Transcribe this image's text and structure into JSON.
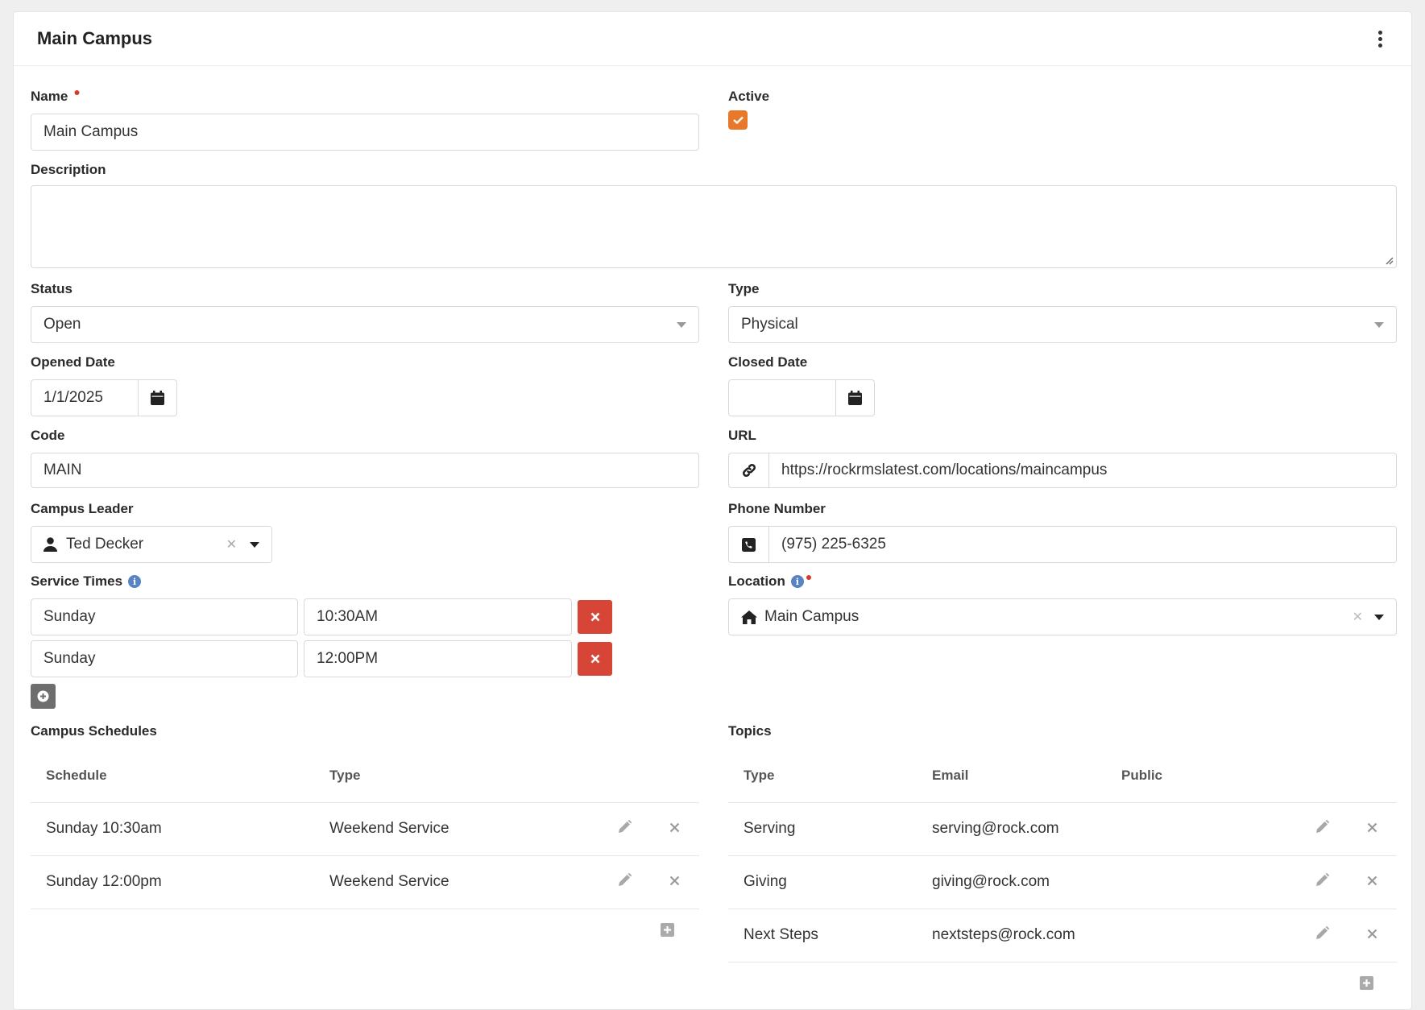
{
  "panel": {
    "title": "Main Campus"
  },
  "name": {
    "label": "Name",
    "value": "Main Campus"
  },
  "active": {
    "label": "Active",
    "checked": true
  },
  "description": {
    "label": "Description",
    "value": ""
  },
  "status": {
    "label": "Status",
    "value": "Open"
  },
  "type": {
    "label": "Type",
    "value": "Physical"
  },
  "opened_date": {
    "label": "Opened Date",
    "value": "1/1/2025"
  },
  "closed_date": {
    "label": "Closed Date",
    "value": ""
  },
  "code": {
    "label": "Code",
    "value": "MAIN"
  },
  "url": {
    "label": "URL",
    "value": "https://rockrmslatest.com/locations/maincampus"
  },
  "campus_leader": {
    "label": "Campus Leader",
    "value": "Ted Decker"
  },
  "phone": {
    "label": "Phone Number",
    "value": "(975) 225-6325"
  },
  "service_times": {
    "label": "Service Times",
    "rows": [
      {
        "day": "Sunday",
        "time": "10:30AM"
      },
      {
        "day": "Sunday",
        "time": "12:00PM"
      }
    ]
  },
  "location": {
    "label": "Location",
    "value": "Main Campus"
  },
  "campus_schedules": {
    "label": "Campus Schedules",
    "columns": [
      "Schedule",
      "Type"
    ],
    "rows": [
      {
        "schedule": "Sunday 10:30am",
        "type": "Weekend Service"
      },
      {
        "schedule": "Sunday 12:00pm",
        "type": "Weekend Service"
      }
    ]
  },
  "topics": {
    "label": "Topics",
    "columns": [
      "Type",
      "Email",
      "Public"
    ],
    "rows": [
      {
        "type": "Serving",
        "email": "serving@rock.com",
        "public": ""
      },
      {
        "type": "Giving",
        "email": "giving@rock.com",
        "public": ""
      },
      {
        "type": "Next Steps",
        "email": "nextsteps@rock.com",
        "public": ""
      }
    ]
  },
  "colors": {
    "accent": "#e8792b",
    "danger": "#d74537",
    "info": "#5a83c1"
  }
}
